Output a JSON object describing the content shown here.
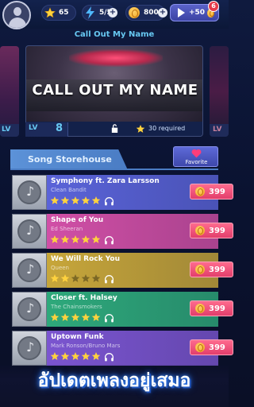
{
  "topbar": {
    "stars": "65",
    "energy": "5/5",
    "coins": "800",
    "video_reward": "+50",
    "notification_count": "6"
  },
  "featured": {
    "section_title": "Call Out My Name",
    "song_title": "CALL OUT MY NAME",
    "requirement": "30 required",
    "left_card_lv": "LV",
    "right_card_lv": "LV",
    "right_card_level": "8"
  },
  "store": {
    "tab_label": "Song Storehouse",
    "favorite_label": "Favorite"
  },
  "songs": [
    {
      "title": "Symphony ft. Zara Larsson",
      "artist": "Clean Bandit",
      "price": "399",
      "stars": 5,
      "color": "#5a63d8"
    },
    {
      "title": "Shape of You",
      "artist": "Ed Sheeran",
      "price": "399",
      "stars": 5,
      "color": "#d14fa6"
    },
    {
      "title": "We Will Rock You",
      "artist": "Queen",
      "price": "399",
      "stars": 2,
      "color": "#c7a63a"
    },
    {
      "title": "Closer ft. Halsey",
      "artist": "The Chainsmokers",
      "price": "399",
      "stars": 5,
      "color": "#2ea97b"
    },
    {
      "title": "Uptown Funk",
      "artist": "Mark Ronson/Bruno Mars",
      "price": "399",
      "stars": 5,
      "color": "#7b55d0"
    }
  ],
  "banner": {
    "text": "อัปเดตเพลงอยู่เสมอ"
  },
  "colors": {
    "accent_blue": "#67c8f2",
    "price_pink": "#e23e6c",
    "star_yellow": "#ffd23e"
  }
}
